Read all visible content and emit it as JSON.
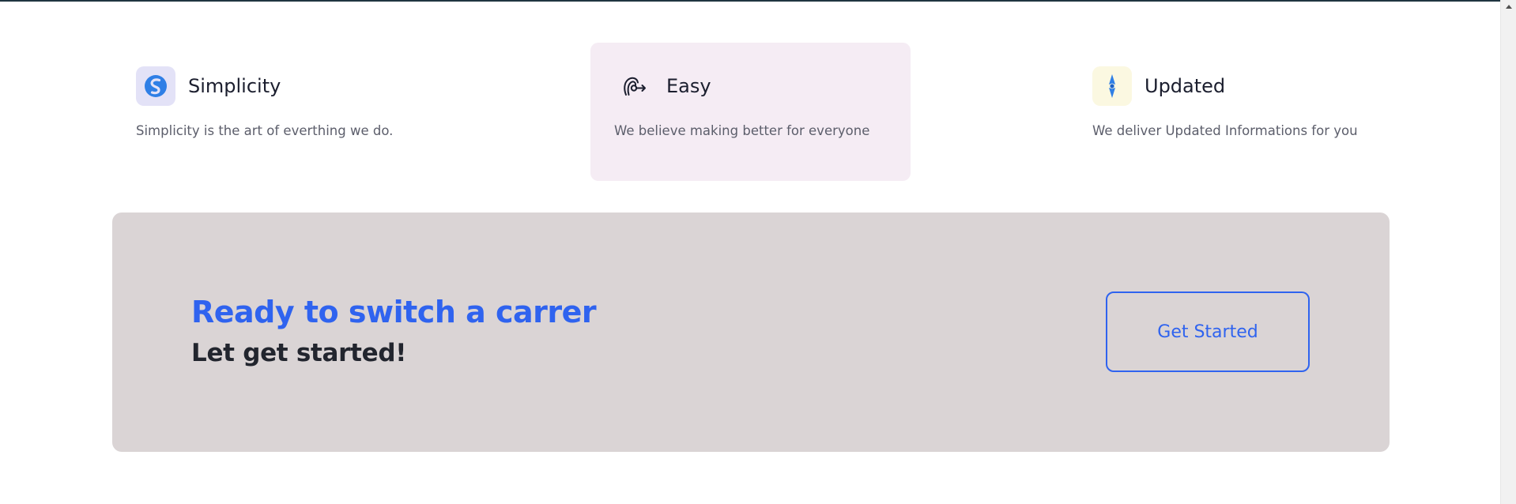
{
  "features": [
    {
      "title": "Simplicity",
      "description": "Simplicity is the art of everthing we do.",
      "icon": "simplenote-logo-icon",
      "icon_bg": "#e3e2f7",
      "icon_color": "#2f7fe6",
      "highlighted": false
    },
    {
      "title": "Easy",
      "description": "We believe making better for everyone",
      "icon": "spiral-arrow-icon",
      "icon_bg": "#f5ecf4",
      "icon_color": "#1b1e2e",
      "highlighted": true
    },
    {
      "title": "Updated",
      "description": "We deliver Updated Informations for you",
      "icon": "compass-needle-icon",
      "icon_bg": "#fbf8e1",
      "icon_color": "#2f7fe6",
      "highlighted": false
    }
  ],
  "cta": {
    "heading": "Ready to switch a carrer",
    "subheading": "Let get started!",
    "button_label": "Get Started",
    "background": "#dad4d5",
    "accent": "#2f63ef"
  }
}
